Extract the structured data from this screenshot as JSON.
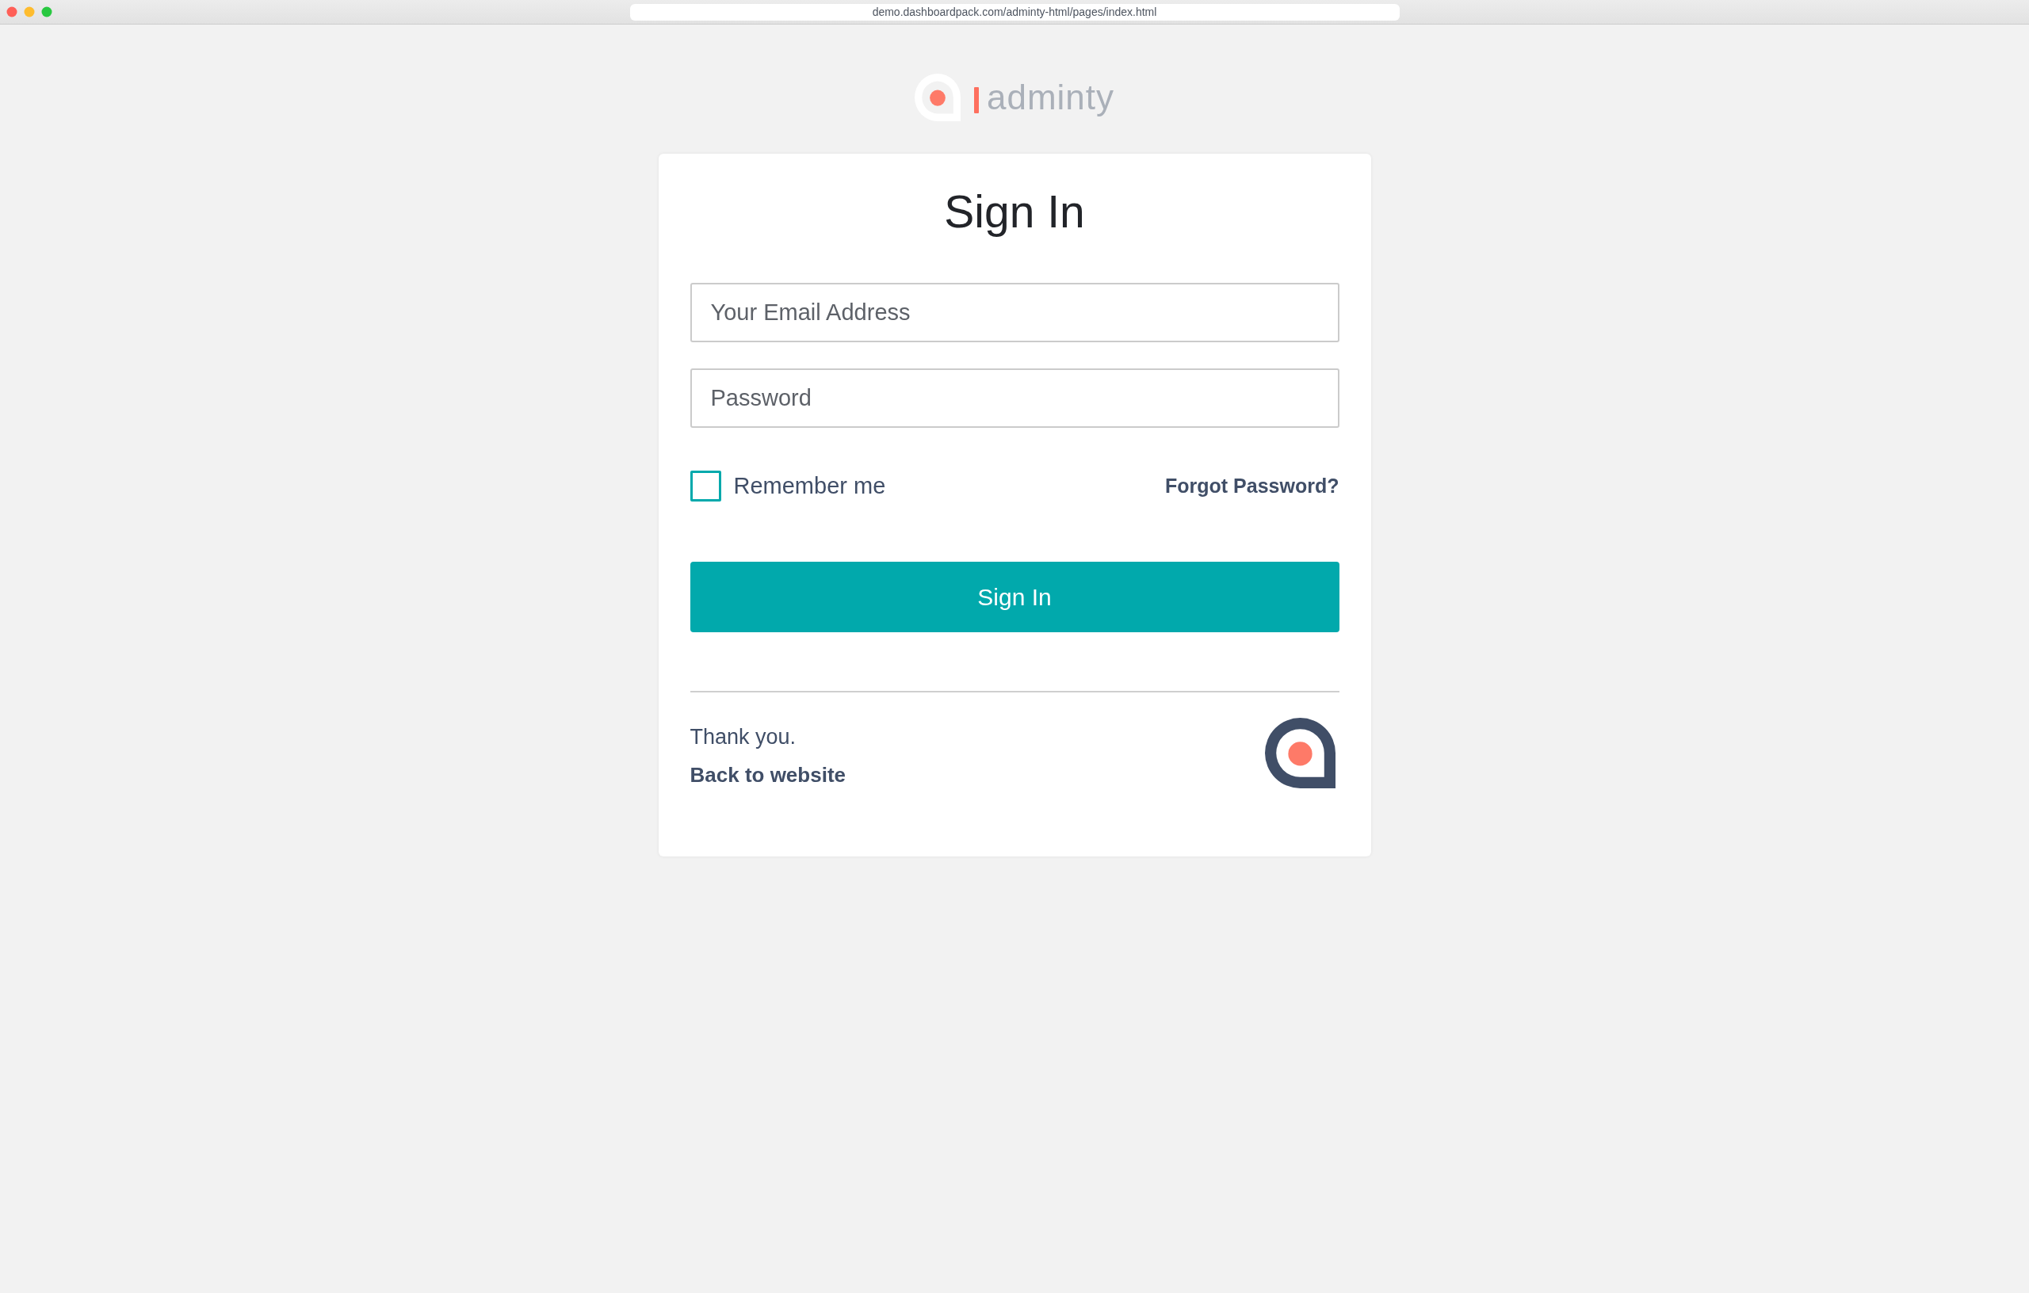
{
  "browser": {
    "url": "demo.dashboardpack.com/adminty-html/pages/index.html"
  },
  "logo": {
    "text": "adminty"
  },
  "card": {
    "title": "Sign In",
    "fields": [
      {
        "placeholder": "Your Email Address"
      },
      {
        "placeholder": "Password"
      }
    ],
    "remember": {
      "label": "Remember me",
      "checked": false
    },
    "forgot_link": "Forgot Password?",
    "submit_button": "Sign In",
    "footer": {
      "message": "Thank you.",
      "back_link": "Back to website"
    }
  }
}
